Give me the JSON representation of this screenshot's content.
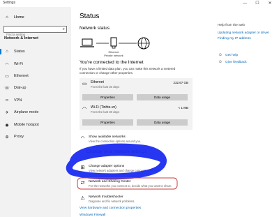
{
  "window": {
    "title": "Settings",
    "min": "—",
    "max": "☐",
    "close": "✕"
  },
  "sidebar": {
    "home": "Home",
    "search_placeholder": "Find a setting",
    "section": "Network & Internet",
    "items": [
      {
        "label": "Status",
        "icon": "globe-icon",
        "glyph": "⌂"
      },
      {
        "label": "Wi-Fi",
        "icon": "wifi-icon",
        "glyph": "◠"
      },
      {
        "label": "Ethernet",
        "icon": "ethernet-icon",
        "glyph": "▭"
      },
      {
        "label": "Dial-up",
        "icon": "phone-icon",
        "glyph": "☏"
      },
      {
        "label": "VPN",
        "icon": "vpn-icon",
        "glyph": "∞"
      },
      {
        "label": "Airplane mode",
        "icon": "airplane-icon",
        "glyph": "✈"
      },
      {
        "label": "Mobile hotspot",
        "icon": "hotspot-icon",
        "glyph": "◉"
      },
      {
        "label": "Proxy",
        "icon": "globe-icon",
        "glyph": "⊕"
      }
    ]
  },
  "main": {
    "title": "Status",
    "network_status": "Network status",
    "diagram": {
      "ethernet": "Ethernet",
      "private": "Private network"
    },
    "connected": "You're connected to the Internet",
    "para": "If you have a limited data plan, you can make this network a metered connection or change other properties.",
    "cards": [
      {
        "name": "Ethernet",
        "sub": "From the last 30 days",
        "usage": "232.67 GB",
        "btn1": "Properties",
        "btn2": "Data usage"
      },
      {
        "name": "Wi-Fi (Tinhte.vn)",
        "sub": "From the last 30 days",
        "usage": "< 1 MB",
        "btn1": "Properties",
        "btn2": "Data usage"
      }
    ],
    "show_networks": {
      "title": "Show available networks",
      "sub": "View the connection options around you."
    },
    "section2": "Change your network settings",
    "change_adapter": {
      "title": "Change adapter options",
      "sub": "View network adapters and change connection settings."
    },
    "sharing_center": {
      "title": "Network and Sharing Center",
      "sub": "For the networks you connect to, decide what you want to share."
    },
    "troubleshooter": {
      "title": "Network troubleshooter",
      "sub": "Diagnose and fix network problems."
    },
    "link_hardware": "View hardware and connection properties",
    "link_firewall": "Windows Firewall"
  },
  "right": {
    "heading": "Help from the web",
    "links": [
      "Updating network adapter or driver",
      "Finding my IP address"
    ],
    "get_help": "Get help",
    "feedback": "Give feedback"
  },
  "colors": {
    "accent": "#0078d7",
    "link": "#0067b8",
    "annotation_blue": "#1b2cf0",
    "annotation_red": "#d23c3c"
  }
}
